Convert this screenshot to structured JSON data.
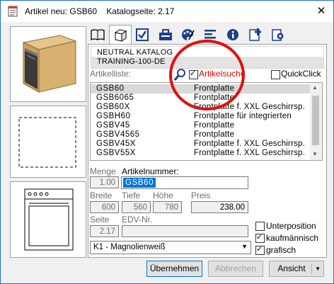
{
  "window": {
    "title": "Artikel neu: GSB60    Katalogseite: 2.17",
    "close_glyph": "✕"
  },
  "catalog": {
    "line1": "NEUTRAL KATALOG",
    "line2": "TRAINING-100-DE"
  },
  "search": {
    "list_label": "Artikelliste:",
    "artikelsuche_label": "Artikelsuche",
    "artikelsuche_checked": true,
    "quickclick_label": "QuickClick",
    "quickclick_checked": false
  },
  "article_list": [
    {
      "code": "GSB60",
      "name": "Frontplatte",
      "selected": true
    },
    {
      "code": "GSB6065",
      "name": "Frontplatte"
    },
    {
      "code": "GSB60X",
      "name": "Frontplatte f. XXL Geschirrsp."
    },
    {
      "code": "GSBH60",
      "name": "Frontplatte für integrierten"
    },
    {
      "code": "GSBV45",
      "name": "Frontplatte"
    },
    {
      "code": "GSBV4565",
      "name": "Frontplatte"
    },
    {
      "code": "GSBV45X",
      "name": "Frontplatte f. XXL Geschirrsp."
    },
    {
      "code": "GSBV55X",
      "name": "Frontplatte f. XXL Geschirrsp."
    }
  ],
  "form": {
    "menge_label": "Menge",
    "menge_value": "1.00",
    "artikelnummer_label": "Artikelnummer:",
    "artikelnummer_value": "GSB60",
    "breite_label": "Breite",
    "breite_value": "600",
    "tiefe_label": "Tiefe",
    "tiefe_value": "560",
    "hoehe_label": "Höhe",
    "hoehe_value": "780",
    "preis_label": "Preis",
    "preis_value": "238.00",
    "seite_label": "Seite",
    "seite_value": "2.17",
    "edv_label": "EDV-Nr.",
    "edv_value": "",
    "unterposition_label": "Unterposition",
    "unterposition_checked": false,
    "kaufmaennisch_label": "kaufmännisch",
    "kaufmaennisch_checked": true,
    "grafisch_label": "grafisch",
    "grafisch_checked": true,
    "variant_value": "K1 - Magnolienweiß"
  },
  "buttons": {
    "uebernehmen": "Übernehmen",
    "abbrechen": "Abbrechen",
    "ansicht": "Ansicht"
  },
  "tabs": [
    {
      "icon": "book-icon"
    },
    {
      "icon": "cube-icon",
      "active": true
    },
    {
      "icon": "checkbox-icon"
    },
    {
      "icon": "toolbox-icon"
    },
    {
      "icon": "palette-icon"
    },
    {
      "icon": "text-lines-icon"
    },
    {
      "icon": "info-icon"
    },
    {
      "icon": "add-document-icon"
    },
    {
      "icon": "settings-document-icon"
    }
  ],
  "colors": {
    "accent_blue": "#0078d7",
    "annotation_red": "#e01010",
    "search_text_red": "#e00000"
  }
}
